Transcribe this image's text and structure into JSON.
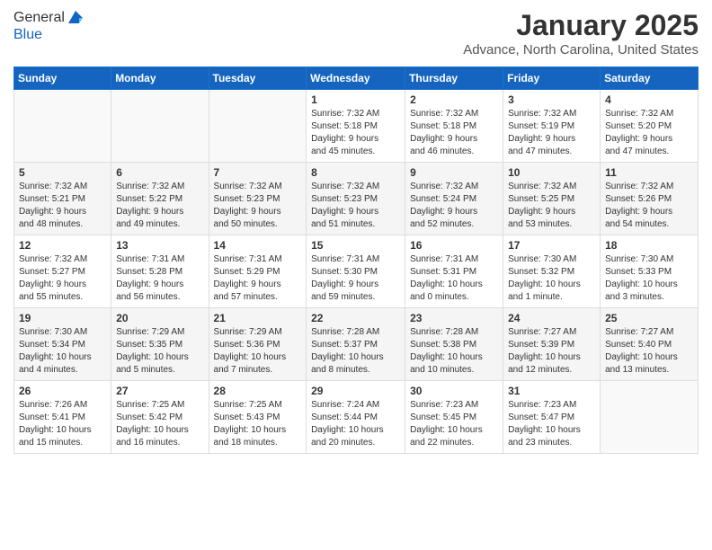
{
  "header": {
    "logo_line1": "General",
    "logo_line2": "Blue",
    "month": "January 2025",
    "location": "Advance, North Carolina, United States"
  },
  "weekdays": [
    "Sunday",
    "Monday",
    "Tuesday",
    "Wednesday",
    "Thursday",
    "Friday",
    "Saturday"
  ],
  "weeks": [
    [
      {
        "day": "",
        "info": ""
      },
      {
        "day": "",
        "info": ""
      },
      {
        "day": "",
        "info": ""
      },
      {
        "day": "1",
        "info": "Sunrise: 7:32 AM\nSunset: 5:18 PM\nDaylight: 9 hours\nand 45 minutes."
      },
      {
        "day": "2",
        "info": "Sunrise: 7:32 AM\nSunset: 5:18 PM\nDaylight: 9 hours\nand 46 minutes."
      },
      {
        "day": "3",
        "info": "Sunrise: 7:32 AM\nSunset: 5:19 PM\nDaylight: 9 hours\nand 47 minutes."
      },
      {
        "day": "4",
        "info": "Sunrise: 7:32 AM\nSunset: 5:20 PM\nDaylight: 9 hours\nand 47 minutes."
      }
    ],
    [
      {
        "day": "5",
        "info": "Sunrise: 7:32 AM\nSunset: 5:21 PM\nDaylight: 9 hours\nand 48 minutes."
      },
      {
        "day": "6",
        "info": "Sunrise: 7:32 AM\nSunset: 5:22 PM\nDaylight: 9 hours\nand 49 minutes."
      },
      {
        "day": "7",
        "info": "Sunrise: 7:32 AM\nSunset: 5:23 PM\nDaylight: 9 hours\nand 50 minutes."
      },
      {
        "day": "8",
        "info": "Sunrise: 7:32 AM\nSunset: 5:23 PM\nDaylight: 9 hours\nand 51 minutes."
      },
      {
        "day": "9",
        "info": "Sunrise: 7:32 AM\nSunset: 5:24 PM\nDaylight: 9 hours\nand 52 minutes."
      },
      {
        "day": "10",
        "info": "Sunrise: 7:32 AM\nSunset: 5:25 PM\nDaylight: 9 hours\nand 53 minutes."
      },
      {
        "day": "11",
        "info": "Sunrise: 7:32 AM\nSunset: 5:26 PM\nDaylight: 9 hours\nand 54 minutes."
      }
    ],
    [
      {
        "day": "12",
        "info": "Sunrise: 7:32 AM\nSunset: 5:27 PM\nDaylight: 9 hours\nand 55 minutes."
      },
      {
        "day": "13",
        "info": "Sunrise: 7:31 AM\nSunset: 5:28 PM\nDaylight: 9 hours\nand 56 minutes."
      },
      {
        "day": "14",
        "info": "Sunrise: 7:31 AM\nSunset: 5:29 PM\nDaylight: 9 hours\nand 57 minutes."
      },
      {
        "day": "15",
        "info": "Sunrise: 7:31 AM\nSunset: 5:30 PM\nDaylight: 9 hours\nand 59 minutes."
      },
      {
        "day": "16",
        "info": "Sunrise: 7:31 AM\nSunset: 5:31 PM\nDaylight: 10 hours\nand 0 minutes."
      },
      {
        "day": "17",
        "info": "Sunrise: 7:30 AM\nSunset: 5:32 PM\nDaylight: 10 hours\nand 1 minute."
      },
      {
        "day": "18",
        "info": "Sunrise: 7:30 AM\nSunset: 5:33 PM\nDaylight: 10 hours\nand 3 minutes."
      }
    ],
    [
      {
        "day": "19",
        "info": "Sunrise: 7:30 AM\nSunset: 5:34 PM\nDaylight: 10 hours\nand 4 minutes."
      },
      {
        "day": "20",
        "info": "Sunrise: 7:29 AM\nSunset: 5:35 PM\nDaylight: 10 hours\nand 5 minutes."
      },
      {
        "day": "21",
        "info": "Sunrise: 7:29 AM\nSunset: 5:36 PM\nDaylight: 10 hours\nand 7 minutes."
      },
      {
        "day": "22",
        "info": "Sunrise: 7:28 AM\nSunset: 5:37 PM\nDaylight: 10 hours\nand 8 minutes."
      },
      {
        "day": "23",
        "info": "Sunrise: 7:28 AM\nSunset: 5:38 PM\nDaylight: 10 hours\nand 10 minutes."
      },
      {
        "day": "24",
        "info": "Sunrise: 7:27 AM\nSunset: 5:39 PM\nDaylight: 10 hours\nand 12 minutes."
      },
      {
        "day": "25",
        "info": "Sunrise: 7:27 AM\nSunset: 5:40 PM\nDaylight: 10 hours\nand 13 minutes."
      }
    ],
    [
      {
        "day": "26",
        "info": "Sunrise: 7:26 AM\nSunset: 5:41 PM\nDaylight: 10 hours\nand 15 minutes."
      },
      {
        "day": "27",
        "info": "Sunrise: 7:25 AM\nSunset: 5:42 PM\nDaylight: 10 hours\nand 16 minutes."
      },
      {
        "day": "28",
        "info": "Sunrise: 7:25 AM\nSunset: 5:43 PM\nDaylight: 10 hours\nand 18 minutes."
      },
      {
        "day": "29",
        "info": "Sunrise: 7:24 AM\nSunset: 5:44 PM\nDaylight: 10 hours\nand 20 minutes."
      },
      {
        "day": "30",
        "info": "Sunrise: 7:23 AM\nSunset: 5:45 PM\nDaylight: 10 hours\nand 22 minutes."
      },
      {
        "day": "31",
        "info": "Sunrise: 7:23 AM\nSunset: 5:47 PM\nDaylight: 10 hours\nand 23 minutes."
      },
      {
        "day": "",
        "info": ""
      }
    ]
  ]
}
